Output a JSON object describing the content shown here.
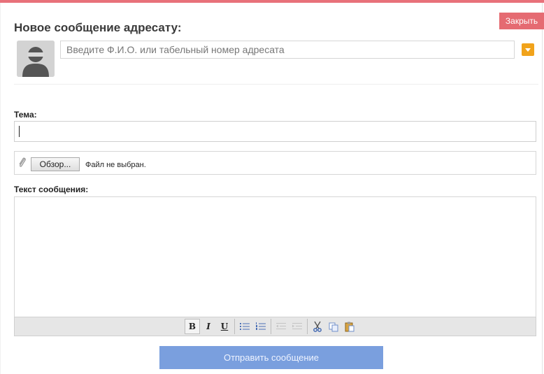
{
  "dialog": {
    "title": "Новое сообщение адресату:",
    "close_label": "Закрыть"
  },
  "recipient": {
    "placeholder": "Введите Ф.И.О. или табельный номер адресата",
    "value": ""
  },
  "subject": {
    "label": "Тема:",
    "value": ""
  },
  "attachment": {
    "browse_label": "Обзор...",
    "status": "Файл не выбран."
  },
  "message": {
    "label": "Текст сообщения:",
    "value": ""
  },
  "toolbar": {
    "bold": "B",
    "italic": "I",
    "underline": "U",
    "icons": [
      "bold-icon",
      "italic-icon",
      "underline-icon",
      "bullet-list-icon",
      "numbered-list-icon",
      "outdent-icon",
      "indent-icon",
      "cut-icon",
      "copy-icon",
      "paste-icon"
    ]
  },
  "send_label": "Отправить сообщение",
  "colors": {
    "accent_top": "#e8717a",
    "close_button": "#e56b72",
    "dropdown": "#f1a31b",
    "send_button": "#7a9fde"
  }
}
